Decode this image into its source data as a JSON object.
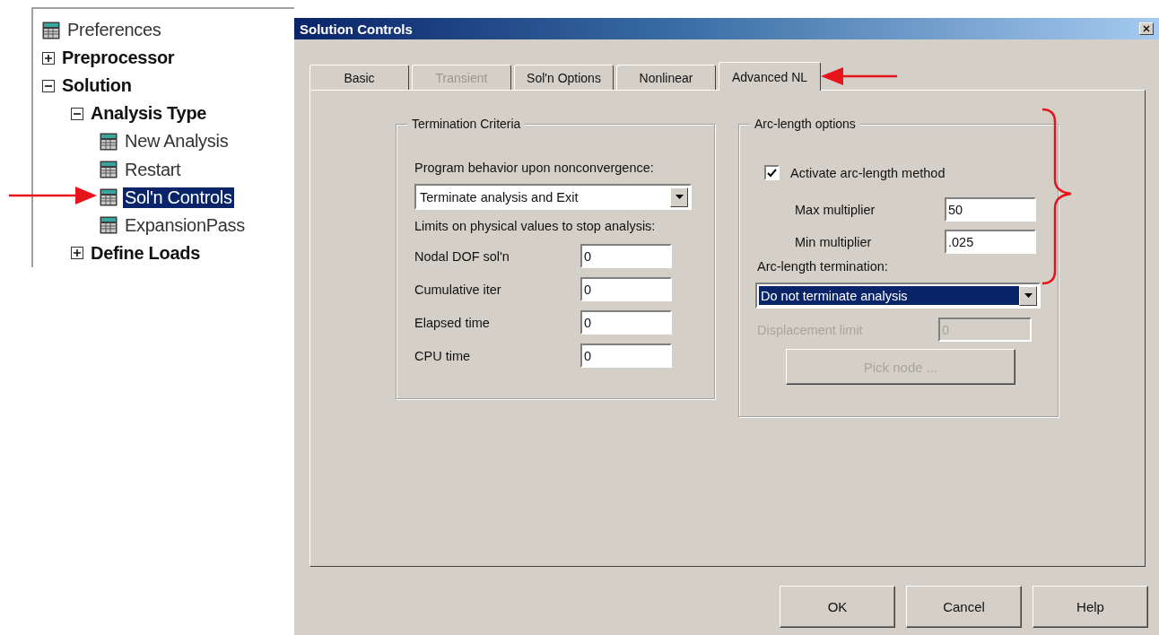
{
  "tree": {
    "items": [
      {
        "label": "Preferences",
        "kind": "leaf",
        "selected": false
      },
      {
        "label": "Preprocessor",
        "kind": "folder",
        "expanded": false,
        "selected": false
      },
      {
        "label": "Solution",
        "kind": "folder",
        "expanded": true,
        "selected": false,
        "children": [
          {
            "label": "Analysis Type",
            "kind": "folder",
            "expanded": true,
            "selected": false,
            "children": [
              {
                "label": "New Analysis",
                "kind": "leaf",
                "selected": false
              },
              {
                "label": "Restart",
                "kind": "leaf",
                "selected": false
              },
              {
                "label": "Sol'n Controls",
                "kind": "leaf",
                "selected": true
              },
              {
                "label": "ExpansionPass",
                "kind": "leaf",
                "selected": false
              }
            ]
          },
          {
            "label": "Define Loads",
            "kind": "folder",
            "expanded": false,
            "selected": false
          }
        ]
      }
    ]
  },
  "dialog": {
    "title": "Solution Controls",
    "tabs": [
      {
        "label": "Basic",
        "selected": false,
        "disabled": false
      },
      {
        "label": "Transient",
        "selected": false,
        "disabled": true
      },
      {
        "label": "Sol'n Options",
        "selected": false,
        "disabled": false
      },
      {
        "label": "Nonlinear",
        "selected": false,
        "disabled": false
      },
      {
        "label": "Advanced NL",
        "selected": true,
        "disabled": false
      }
    ],
    "termination": {
      "title": "Termination Criteria",
      "behavior_label": "Program behavior upon nonconvergence:",
      "behavior_select": {
        "value": "Terminate analysis and Exit",
        "focused": false
      },
      "limits_label": "Limits on physical values to stop analysis:",
      "fields": [
        {
          "label": "Nodal DOF sol'n",
          "value": "0"
        },
        {
          "label": "Cumulative iter",
          "value": "0"
        },
        {
          "label": "Elapsed time",
          "value": "0"
        },
        {
          "label": "CPU time",
          "value": "0"
        }
      ]
    },
    "arc_length": {
      "title": "Arc-length options",
      "activate": {
        "label": "Activate arc-length method",
        "checked": true
      },
      "fields": [
        {
          "label": "Max multiplier",
          "value": "50"
        },
        {
          "label": "Min multiplier",
          "value": ".025"
        }
      ],
      "termination_label": "Arc-length termination:",
      "termination_select": {
        "value": "Do not terminate analysis",
        "focused": true
      },
      "displacement": {
        "label": "Displacement limit",
        "value": "0",
        "disabled": true
      },
      "pick_node": {
        "label": "Pick node ...",
        "disabled": true
      }
    },
    "buttons": [
      "OK",
      "Cancel",
      "Help"
    ]
  }
}
